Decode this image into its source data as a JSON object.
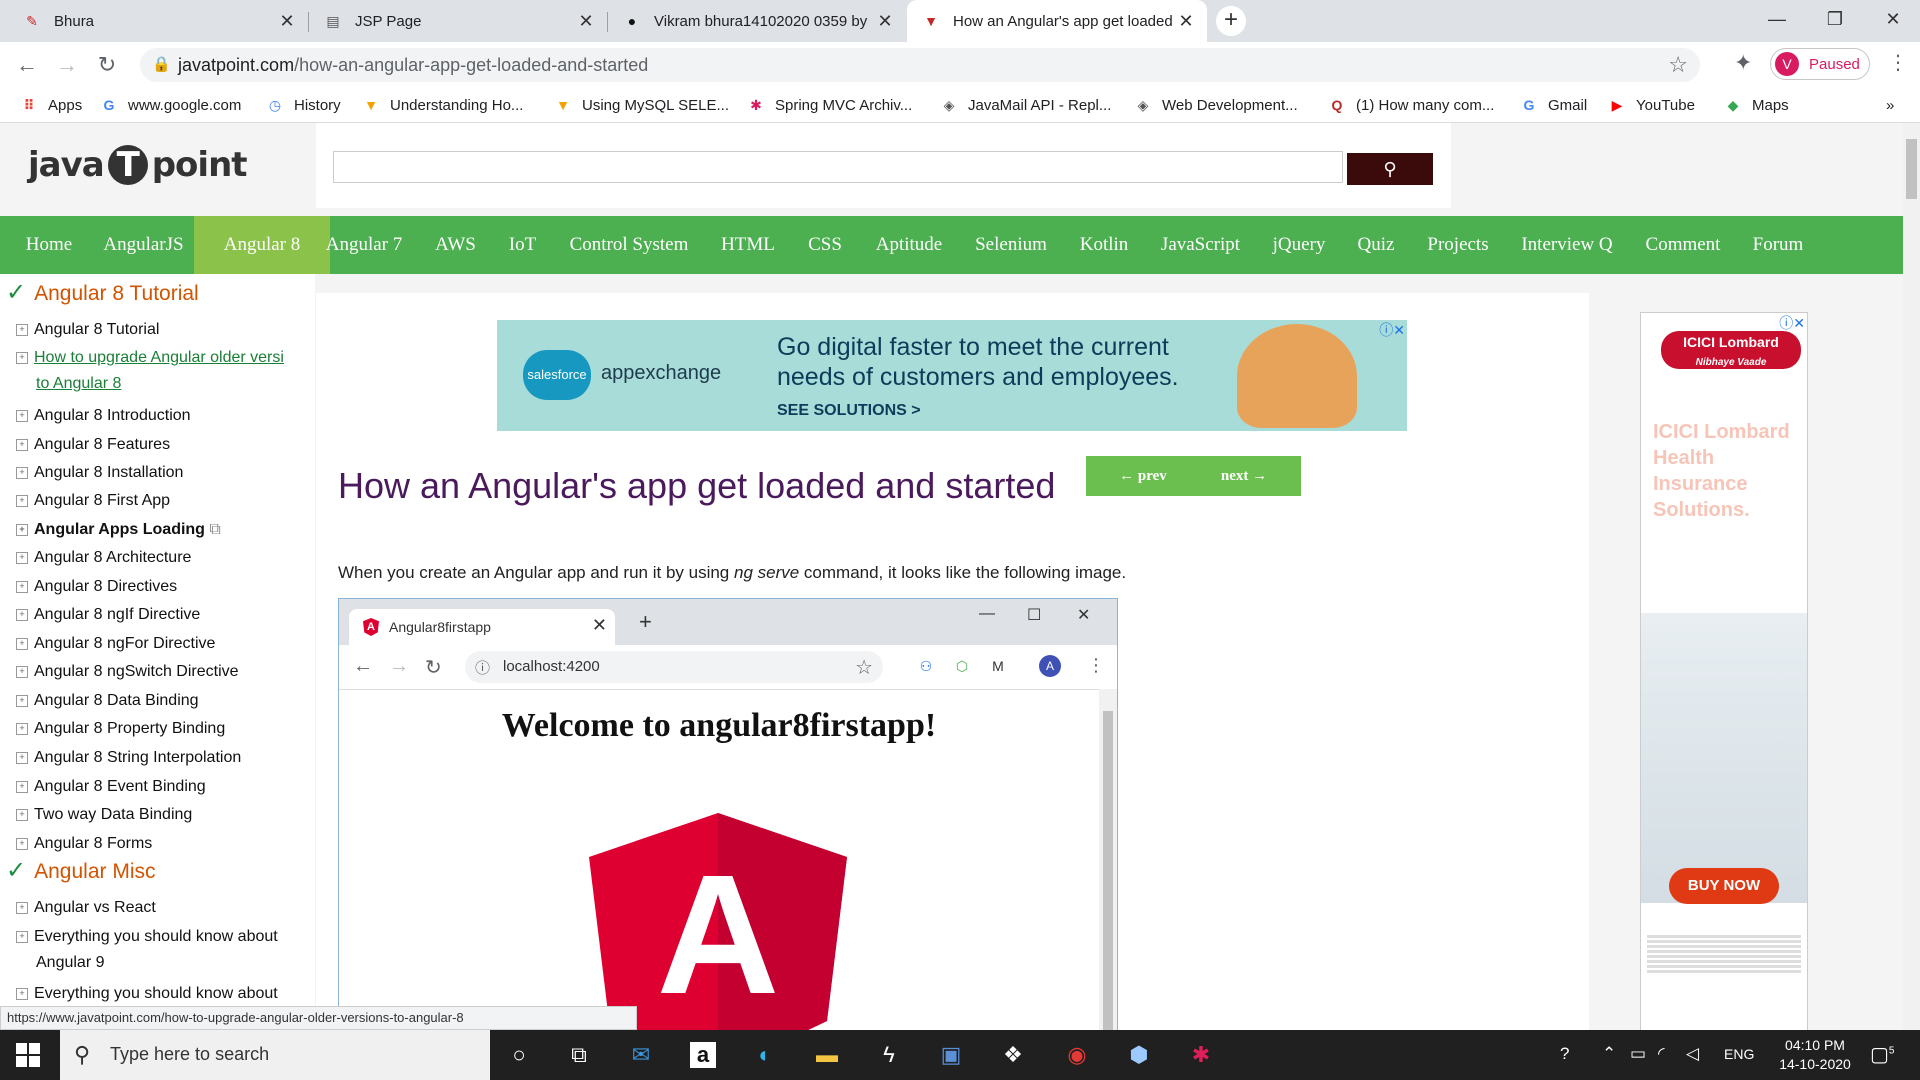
{
  "browser": {
    "tabs": [
      {
        "title": "Bhura",
        "icon": "chrome-scribble-icon",
        "color": "#c62828"
      },
      {
        "title": "JSP Page",
        "icon": "page-icon",
        "color": "#555555"
      },
      {
        "title": "Vikram bhura14102020 0359 by",
        "icon": "github-icon",
        "color": "#111111"
      },
      {
        "title": "How an Angular's app get loaded",
        "icon": "javatpoint-icon",
        "color": "#c62828",
        "active": true
      }
    ],
    "new_tab": "+",
    "window_controls": {
      "minimize": "—",
      "restore": "❐",
      "close": "✕"
    },
    "url_host": "javatpoint.com",
    "url_path": "/how-an-angular-app-get-loaded-and-started",
    "profile_initial": "V",
    "profile_label": "Paused",
    "bookmarks": [
      {
        "label": "Apps",
        "icon": "apps-grid-icon",
        "color": "#ea4335"
      },
      {
        "label": "www.google.com",
        "icon": "google-icon",
        "color": "#4285f4"
      },
      {
        "label": "History",
        "icon": "history-icon",
        "color": "#4285f4"
      },
      {
        "label": "Understanding Ho...",
        "icon": "javatpoint-icon",
        "color": "#f4a100"
      },
      {
        "label": "Using MySQL SELE...",
        "icon": "javatpoint-icon",
        "color": "#f4a100"
      },
      {
        "label": "Spring MVC Archiv...",
        "icon": "spring-icon",
        "color": "#d81b60"
      },
      {
        "label": "JavaMail API - Repl...",
        "icon": "diamond-icon",
        "color": "#555555"
      },
      {
        "label": "Web Development...",
        "icon": "diamond-icon",
        "color": "#555555"
      },
      {
        "label": "(1) How many com...",
        "icon": "quora-icon",
        "color": "#b92b27"
      },
      {
        "label": "Gmail",
        "icon": "google-icon",
        "color": "#4285f4"
      },
      {
        "label": "YouTube",
        "icon": "youtube-icon",
        "color": "#ff0000"
      },
      {
        "label": "Maps",
        "icon": "maps-icon",
        "color": "#34a853"
      }
    ],
    "bookmarks_more": "»"
  },
  "site": {
    "logo_left": "java",
    "logo_mid": "T",
    "logo_right": "point",
    "nav": [
      "Home",
      "AngularJS",
      "Angular 8",
      "Angular 7",
      "AWS",
      "IoT",
      "Control System",
      "HTML",
      "CSS",
      "Aptitude",
      "Selenium",
      "Kotlin",
      "JavaScript",
      "jQuery",
      "Quiz",
      "Projects",
      "Interview Q",
      "Comment",
      "Forum"
    ],
    "nav_active": "Angular 8",
    "sidebar": {
      "heading1": "Angular 8 Tutorial",
      "items1": [
        "Angular 8 Tutorial",
        "How to upgrade Angular older versi",
        "to Angular 8",
        "Angular 8 Introduction",
        "Angular 8 Features",
        "Angular 8 Installation",
        "Angular 8 First App",
        "Angular Apps Loading",
        "Angular 8 Architecture",
        "Angular 8 Directives",
        "Angular 8 ngIf Directive",
        "Angular 8 ngFor Directive",
        "Angular 8 ngSwitch Directive",
        "Angular 8 Data Binding",
        "Angular 8 Property Binding",
        "Angular 8 String Interpolation",
        "Angular 8 Event Binding",
        "Two way Data Binding",
        "Angular 8 Forms"
      ],
      "heading2": "Angular Misc",
      "items2": [
        "Angular vs React",
        "Everything you should know about",
        "Angular 9",
        "Everything you should know about"
      ]
    },
    "ad_banner": {
      "brand": "salesforce",
      "app": "appexchange",
      "line1": "Go digital faster to meet the current",
      "line2": "needs of customers and employees.",
      "cta": "SEE SOLUTIONS >"
    },
    "title": "How an Angular's app get loaded and started",
    "prev": "← prev",
    "next": "next →",
    "intro_before": "When you create an Angular app and run it by using ",
    "intro_em": "ng serve",
    "intro_after": " command, it looks like the following image.",
    "screenshot": {
      "tab_title": "Angular8firstapp",
      "favicon_letter": "A",
      "url": "localhost:4200",
      "avatar": "A",
      "welcome": "Welcome to angular8firstapp!",
      "logo_letter": "A"
    },
    "right_ad": {
      "brand": "ICICI Lombard",
      "tagline": "Nibhaye Vaade",
      "headline": "ICICI Lombard Health Insurance Solutions.",
      "cta": "BUY NOW"
    }
  },
  "status_url": "https://www.javatpoint.com/how-to-upgrade-angular-older-versions-to-angular-8",
  "taskbar": {
    "search_placeholder": "Type here to search",
    "lang": "ENG",
    "time": "04:10 PM",
    "date": "14-10-2020",
    "notifications": "5"
  }
}
